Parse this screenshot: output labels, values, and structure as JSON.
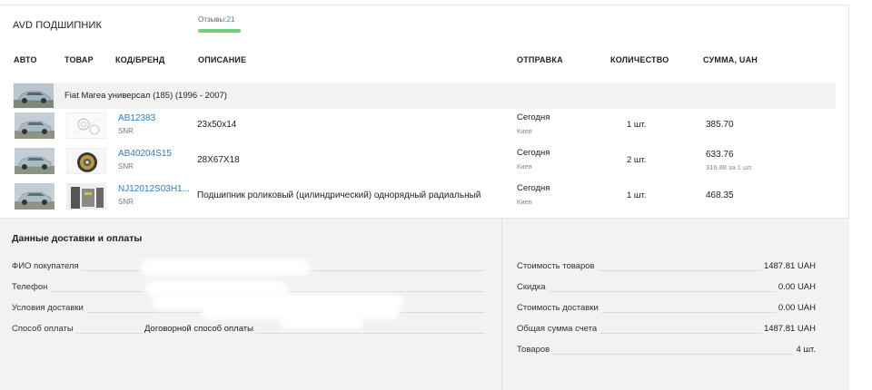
{
  "order": {
    "seller": "AVD ПОДШИПНИК",
    "reviews_label": "Отзывы:",
    "reviews_count": "21"
  },
  "columns": {
    "auto": "АВТО",
    "product": "ТОВАР",
    "code_brand": "КОД/БРЕНД",
    "description": "ОПИСАНИЕ",
    "shipping": "ОТПРАВКА",
    "quantity": "КОЛИЧЕСТВО",
    "sum": "СУММА, UAH"
  },
  "vehicle": {
    "title": "Fiat Marea универсал (185) (1996 - 2007)"
  },
  "items": [
    {
      "code": "AB12383",
      "brand": "SNR",
      "description": "23x50x14",
      "ship": "Сегодня",
      "city": "Киев",
      "qty": "1 шт.",
      "sum": "385.70",
      "per_unit": ""
    },
    {
      "code": "AB40204S15",
      "brand": "SNR",
      "description": "28X67X18",
      "ship": "Сегодня",
      "city": "Киев",
      "qty": "2 шт.",
      "sum": "633.76",
      "per_unit": "316.88 за 1 шт."
    },
    {
      "code": "NJ12012S03H1...",
      "brand": "SNR",
      "description": "Подшипник роликовый (цилиндрический) однорядный радиальный",
      "ship": "Сегодня",
      "city": "Киев",
      "qty": "1 шт.",
      "sum": "468.35",
      "per_unit": ""
    }
  ],
  "delivery": {
    "title": "Данные доставки и оплаты",
    "buyer_label": "ФИО покупателя",
    "phone_label": "Телефон",
    "conditions_label": "Условия доставки",
    "payment_label": "Способ оплаты",
    "payment_value": "Договорной способ оплаты"
  },
  "totals": {
    "goods_label": "Стоимость товаров",
    "goods_value": "1487.81 UAH",
    "discount_label": "Скидка",
    "discount_value": "0.00 UAH",
    "delivery_label": "Стоимость доставки",
    "delivery_value": "0.00 UAH",
    "total_label": "Общая сумма счета",
    "total_value": "1487.81 UAH",
    "count_label": "Товаров",
    "count_value": "4 шт."
  },
  "colors": {
    "link": "#2a7fc8",
    "reviews_bar": "#6fcf7f",
    "panel_bg": "#f2f2f2"
  }
}
